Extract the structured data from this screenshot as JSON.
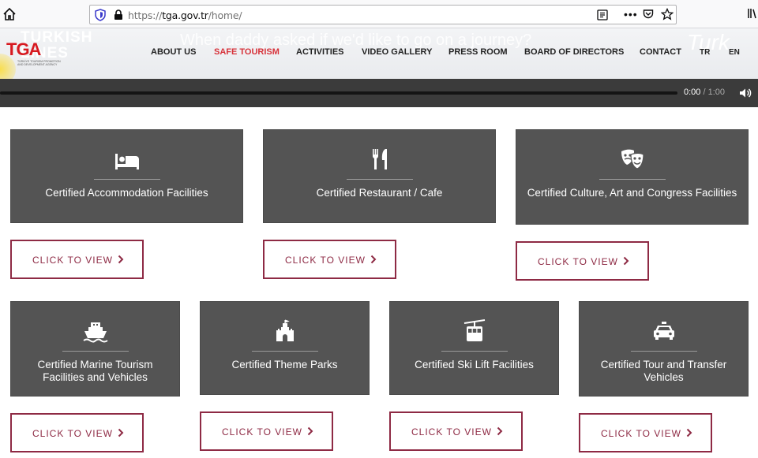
{
  "browser": {
    "url_prefix": "https://",
    "url_host": "tga.gov.tr",
    "url_path": "/home/"
  },
  "header": {
    "bg_left_text": "TURKISH\nLINES",
    "bg_center_text": "When daddy asked if we'd like to go on a journey?",
    "logo_text": "TGA",
    "logo_sub": "TÜRKİYE TOURISM PROMOTION AND DEVELOPMENT AGENCY",
    "nav": [
      {
        "label": "ABOUT US"
      },
      {
        "label": "SAFE TOURISM"
      },
      {
        "label": "ACTIVITIES"
      },
      {
        "label": "VIDEO GALLERY"
      },
      {
        "label": "PRESS ROOM"
      },
      {
        "label": "BOARD OF DIRECTORS"
      },
      {
        "label": "CONTACT"
      },
      {
        "label": "TR"
      },
      {
        "label": "EN"
      }
    ]
  },
  "video": {
    "current_time": "0:00",
    "separator": " / ",
    "total_time": "1:00"
  },
  "cards": [
    {
      "title": "Certified Accommodation Facilities",
      "icon": "bed-icon"
    },
    {
      "title": "Certified Restaurant / Cafe",
      "icon": "fork-knife-icon"
    },
    {
      "title": "Certified Culture, Art and Congress Facilities",
      "icon": "theater-masks-icon"
    },
    {
      "title": "Certified Marine Tourism Facilities and Vehicles",
      "icon": "ship-icon"
    },
    {
      "title": "Certified Theme Parks",
      "icon": "castle-icon"
    },
    {
      "title": "Certified Ski Lift Facilities",
      "icon": "cable-car-icon"
    },
    {
      "title": "Certified Tour and Transfer Vehicles",
      "icon": "car-icon"
    }
  ],
  "cta_label": "CLICK TO VIEW",
  "colors": {
    "accent": "#8e2a44",
    "nav_active": "#d7323a",
    "card_bg": "#545454"
  }
}
